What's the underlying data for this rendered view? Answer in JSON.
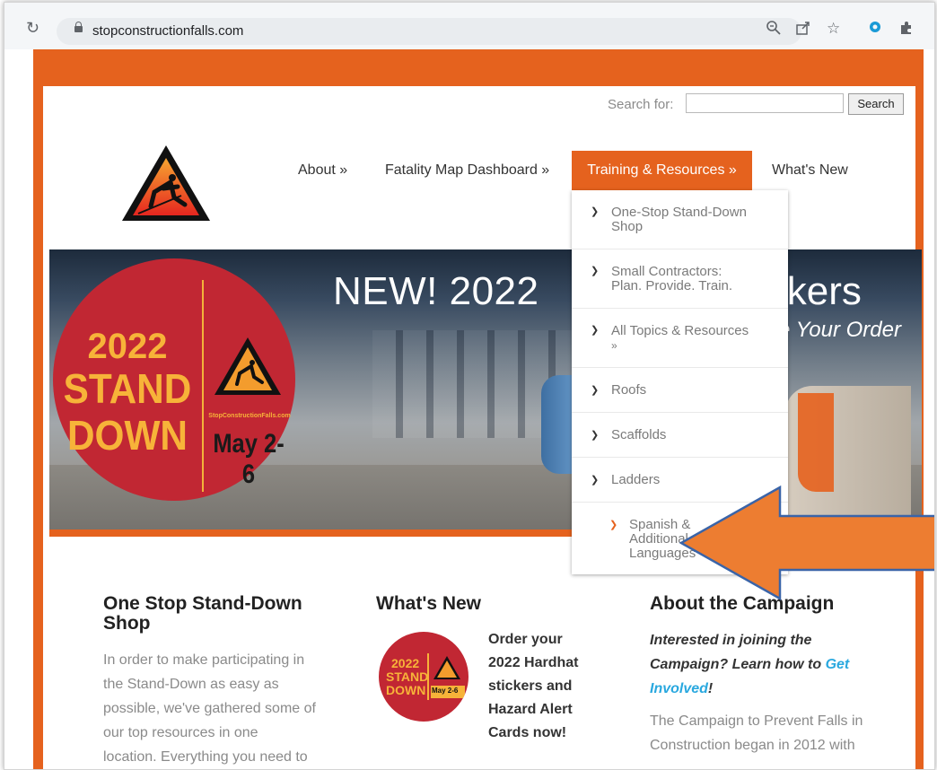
{
  "browser": {
    "url": "stopconstructionfalls.com",
    "icons": [
      "reload-icon",
      "lock-icon",
      "zoom-icon",
      "share-icon",
      "star-icon",
      "extension-blue-icon",
      "puzzle-icon"
    ]
  },
  "search": {
    "label": "Search for:",
    "value": "",
    "button": "Search"
  },
  "nav": {
    "about": "About »",
    "fatality_map": "Fatality Map Dashboard »",
    "training": "Training & Resources »",
    "whats_new": "What's New"
  },
  "dropdown": {
    "items": [
      {
        "line1": "One-Stop Stand-Down",
        "line2": "Shop"
      },
      {
        "line1": "Small Contractors:",
        "line2": "Plan. Provide. Train."
      },
      {
        "line1": "All Topics & Resources",
        "line2": "»"
      },
      {
        "line1": "Roofs",
        "line2": ""
      },
      {
        "line1": "Scaffolds",
        "line2": ""
      },
      {
        "line1": "Ladders",
        "line2": ""
      },
      {
        "line1": "Spanish &",
        "line2": "Additional",
        "line3": "Languages"
      }
    ]
  },
  "hero": {
    "title_left": "NEW! 2022",
    "title_right": "ickers",
    "subtitle": "e Your Order",
    "badge": {
      "year": "2022",
      "word1": "STAND",
      "word2": "DOWN",
      "site": "StopConstructionFalls.com",
      "date": "May 2-6"
    }
  },
  "columns": {
    "shop": {
      "title1": "One Stop Stand-Down",
      "title2": "Shop",
      "lines": [
        "In order to make participating in",
        "the Stand-Down as easy as",
        "possible, we've gathered some of",
        "our top resources in one",
        "location.  Everything you need to"
      ]
    },
    "whats_new": {
      "title": "What's New",
      "lines": [
        "Order your",
        "2022 Hardhat",
        "stickers and",
        "Hazard Alert",
        "Cards now!"
      ],
      "badge": {
        "year": "2022",
        "word1": "STAND",
        "word2": "DOWN",
        "date": "May 2-6"
      }
    },
    "about": {
      "title": "About the Campaign",
      "q_line1": "Interested in joining the",
      "q_line2a": "Campaign? Learn how to ",
      "q_link1": "Get",
      "q_link2": "Involved",
      "q_end": "!",
      "body": [
        "The Campaign to Prevent Falls in",
        "Construction began in 2012 with"
      ]
    }
  },
  "colors": {
    "brand_orange": "#e5621e",
    "badge_red": "#c12733",
    "badge_gold": "#f7b339",
    "link_blue": "#29a8df"
  }
}
